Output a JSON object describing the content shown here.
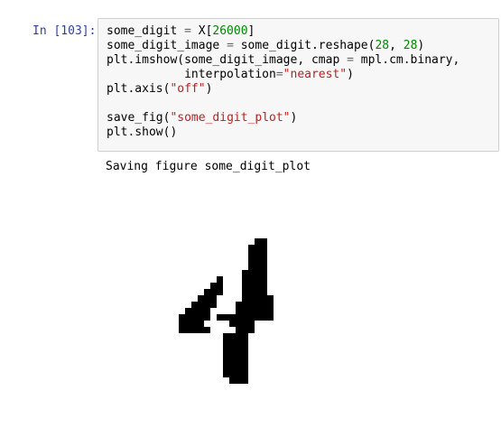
{
  "cell": {
    "prompt": "In [103]:",
    "code_lines": [
      [
        {
          "t": "some_digit "
        },
        {
          "t": "=",
          "c": "o"
        },
        {
          "t": " X["
        },
        {
          "t": "26000",
          "c": "n"
        },
        {
          "t": "]"
        }
      ],
      [
        {
          "t": "some_digit_image "
        },
        {
          "t": "=",
          "c": "o"
        },
        {
          "t": " some_digit.reshape("
        },
        {
          "t": "28",
          "c": "n"
        },
        {
          "t": ", "
        },
        {
          "t": "28",
          "c": "n"
        },
        {
          "t": ")"
        }
      ],
      [
        {
          "t": "plt.imshow(some_digit_image, cmap "
        },
        {
          "t": "=",
          "c": "o"
        },
        {
          "t": " mpl.cm.binary,"
        }
      ],
      [
        {
          "t": "           interpolation"
        },
        {
          "t": "=",
          "c": "o"
        },
        {
          "t": "\"nearest\"",
          "c": "s"
        },
        {
          "t": ")"
        }
      ],
      [
        {
          "t": "plt.axis("
        },
        {
          "t": "\"off\"",
          "c": "s"
        },
        {
          "t": ")"
        }
      ],
      [
        {
          "t": ""
        }
      ],
      [
        {
          "t": "save_fig("
        },
        {
          "t": "\"some_digit_plot\"",
          "c": "s"
        },
        {
          "t": ")"
        }
      ],
      [
        {
          "t": "plt.show()"
        }
      ]
    ]
  },
  "output": {
    "text": "Saving figure some_digit_plot"
  },
  "figure": {
    "description_icon": "mnist-digit-image",
    "grid_cols": 28,
    "grid_rows": 28,
    "pixel_rows": [
      "............................",
      "............................",
      "................##..........",
      "...............###..........",
      "...............###..........",
      "...............###..........",
      "...............###..........",
      "..............####..........",
      "..........#...####..........",
      ".........##...####..........",
      "........###...####..........",
      ".......###....#####.........",
      "......####...######.........",
      ".....####....######.........",
      "....#####.#########.........",
      "....####....####............",
      "....#####....###............",
      "...........####.............",
      "...........####.............",
      "...........####.............",
      "...........####.............",
      "...........####.............",
      "...........####.............",
      "...........####.............",
      "............###.............",
      "............................",
      "............................",
      "............................"
    ]
  }
}
